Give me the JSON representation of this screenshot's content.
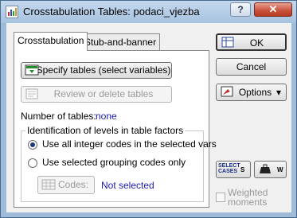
{
  "window": {
    "title": "Crosstabulation Tables: podaci_vjezba",
    "help_label": "?",
    "close_label": "✕"
  },
  "tabs": [
    {
      "label": "Crosstabulation"
    },
    {
      "label": "Stub-and-banner"
    }
  ],
  "main": {
    "specify_label": "Specify tables (select variables)",
    "review_label": "Review or delete tables",
    "num_tables_label": "Number of tables:",
    "num_tables_value": "none",
    "group_title": "Identification of levels in table factors",
    "radio_integer_label": "Use all integer codes in the selected vars",
    "radio_selected_label": "Use selected grouping codes only",
    "codes_label": "Codes:",
    "codes_value": "Not selected"
  },
  "side": {
    "ok_label": "OK",
    "cancel_label": "Cancel",
    "options_label": "Options",
    "select_cases_label": "SELECT CASES",
    "select_cases_s": "S",
    "weight_w": "W",
    "weighted_label_1": "Weighted",
    "weighted_label_2": "moments"
  }
}
